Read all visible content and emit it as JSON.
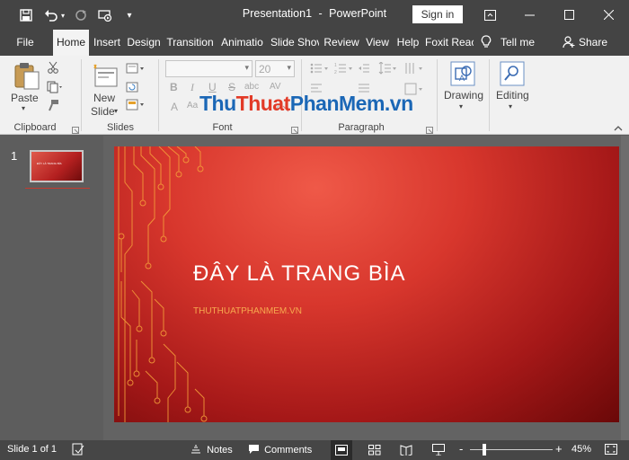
{
  "window": {
    "title_file": "Presentation1",
    "title_sep": "-",
    "title_app": "PowerPoint",
    "signin_label": "Sign in"
  },
  "tabs": [
    {
      "label": "File"
    },
    {
      "label": "Home"
    },
    {
      "label": "Insert"
    },
    {
      "label": "Design"
    },
    {
      "label": "Transition"
    },
    {
      "label": "Animatio"
    },
    {
      "label": "Slide Shov"
    },
    {
      "label": "Review"
    },
    {
      "label": "View"
    },
    {
      "label": "Help"
    },
    {
      "label": "Foxit Reac"
    },
    {
      "label": "Tell me"
    },
    {
      "label": "Share"
    }
  ],
  "ribbon": {
    "clipboard": {
      "paste_label": "Paste",
      "group_label": "Clipboard"
    },
    "slides": {
      "new_label": "New",
      "slide_label": "Slide",
      "group_label": "Slides"
    },
    "font": {
      "size": "20",
      "group_label": "Font",
      "bold": "B",
      "italic": "I",
      "underline": "U",
      "strike": "S",
      "shadow": "abc",
      "spacing": "AV",
      "aa": "Aa",
      "font_color": "A"
    },
    "paragraph": {
      "group_label": "Paragraph"
    },
    "drawing": {
      "label": "Drawing"
    },
    "editing": {
      "label": "Editing"
    }
  },
  "watermark": {
    "part1": "Thu",
    "part2": "Thuat",
    "part3": "PhanMem.vn"
  },
  "slides_pane": {
    "slide_number": "1",
    "thumb_text": "ĐÂY LÀ TRANG BÌA"
  },
  "slide": {
    "title": "ĐÂY LÀ TRANG BÌA",
    "subtitle": "THUTHUATPHANMEM.VN"
  },
  "status": {
    "slide_info": "Slide 1 of 1",
    "notes_label": "Notes",
    "comments_label": "Comments",
    "zoom_minus": "-",
    "zoom_plus": "+",
    "zoom": "45%",
    "zoom_fraction": 0.45
  },
  "colors": {
    "titlebar": "#444444",
    "ribbon": "#f1f1f1",
    "slide_red": "#d8372d",
    "slide_subtitle": "#f7a94f",
    "circuit": "#f5a03a"
  }
}
